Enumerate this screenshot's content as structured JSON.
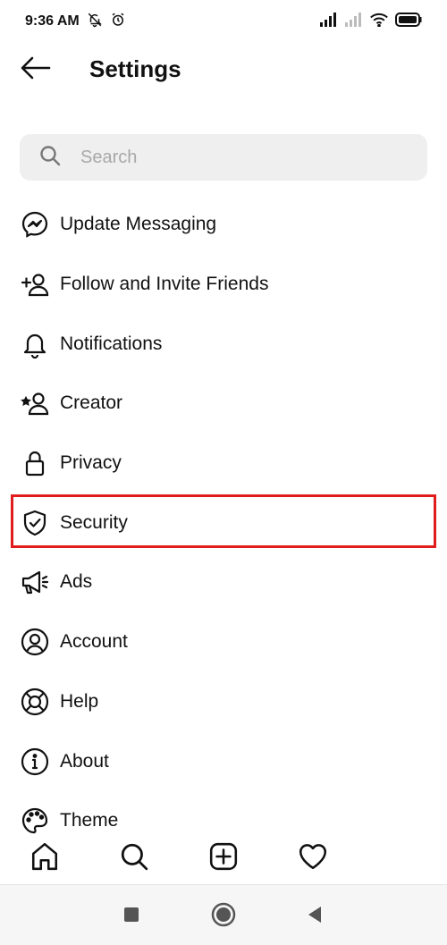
{
  "status_bar": {
    "time": "9:36 AM"
  },
  "header": {
    "title": "Settings"
  },
  "search": {
    "placeholder": "Search"
  },
  "menu": {
    "items": [
      {
        "label": "Update Messaging",
        "icon": "messenger-icon"
      },
      {
        "label": "Follow and Invite Friends",
        "icon": "add-person-icon"
      },
      {
        "label": "Notifications",
        "icon": "bell-icon"
      },
      {
        "label": "Creator",
        "icon": "creator-icon"
      },
      {
        "label": "Privacy",
        "icon": "lock-icon"
      },
      {
        "label": "Security",
        "icon": "shield-check-icon",
        "highlighted": true
      },
      {
        "label": "Ads",
        "icon": "megaphone-icon"
      },
      {
        "label": "Account",
        "icon": "account-circle-icon"
      },
      {
        "label": "Help",
        "icon": "lifebuoy-icon"
      },
      {
        "label": "About",
        "icon": "info-icon"
      },
      {
        "label": "Theme",
        "icon": "palette-icon"
      }
    ]
  },
  "tab_bar": {
    "tabs": [
      "home-icon",
      "search-icon",
      "new-post-icon",
      "heart-icon"
    ]
  },
  "android_nav": {
    "buttons": [
      "recents-icon",
      "home-circle-icon",
      "back-triangle-icon"
    ]
  },
  "colors": {
    "highlight": "#e11c1c",
    "search_bg": "#efefef",
    "placeholder": "#a8a8a8"
  }
}
